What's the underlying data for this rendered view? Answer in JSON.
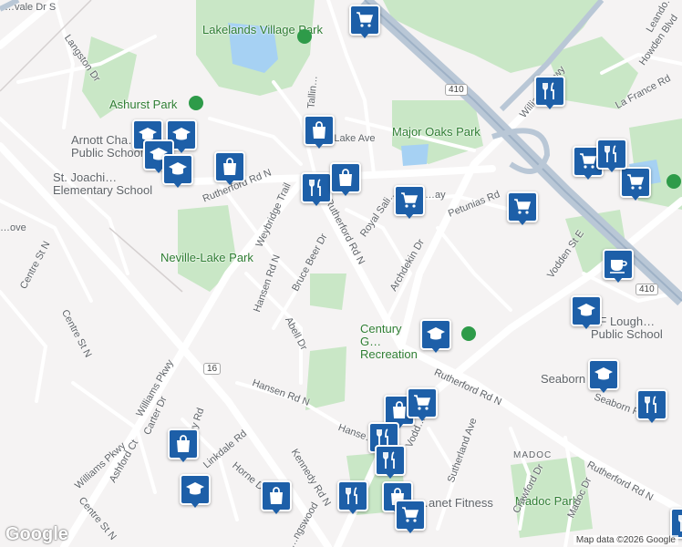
{
  "map": {
    "attribution": "Map data ©2026 Google",
    "logo": "Google",
    "colors": {
      "background": "#f5f3f3",
      "park": "#c9e7c6",
      "water": "#a6d1f3",
      "highway": "#b9c7d6",
      "road": "#ffffff",
      "marker": "#1d5fa8"
    }
  },
  "parks": {
    "lakelands": "Lakelands Village Park",
    "ashurst": "Ashurst Park",
    "major_oaks": "Major Oaks Park",
    "neville_lake": "Neville-Lake Park",
    "madoc": "Madoc Park",
    "century_gardens": "Century G… Recreation"
  },
  "places": {
    "arnott": "Arnott Cha… Public School",
    "st_joachim": "St. Joachi… Elementary School",
    "hf_lough": "HF Lough… Public School",
    "seaborn": "Seaborn",
    "madoc_label": "MADOC",
    "fitness": "…anet Fitness"
  },
  "streets": {
    "rutherford_w": "Rutherford Rd N",
    "rutherford_mid": "Rutherford Rd N",
    "rutherford_e": "Rutherford Rd N",
    "rutherford_se": "Rutherford Rd N",
    "williams1": "Williams Pkwy",
    "williams2": "Williams Pkwy",
    "williams3": "Williams Pkwy",
    "kennedy": "Kennedy Rd N",
    "centre1": "Centre St N",
    "centre2": "Centre St N",
    "centre3": "Centre St N",
    "vodden": "Vodden St E",
    "howden": "Howden Blvd",
    "hansen1": "Hansen Rd N",
    "hansen2": "Hansen Rd N",
    "hansen3": "Hanse…",
    "bruce_beer": "Bruce Beer Dr",
    "abell": "Abell Dr",
    "archdekin": "Archdekin Dr",
    "petunias": "Petunias Rd",
    "royal_salisbury": "Royal Sali…",
    "way": "…ay",
    "weybridge": "Weybridge Trail",
    "langston": "Langston Dr",
    "tallin": "Tallin…",
    "lake_ave": "S… Lake Ave",
    "la_france": "La France Rd",
    "leander": "Leando…",
    "lvale": "…vale Dr S",
    "sutherland": "Sutherland Ave",
    "crawford": "Crawford Dr",
    "madoc_dr": "Madoc Dr",
    "carter": "Carter Dr",
    "ashford": "Ashford Ct",
    "rugby": "Rugby Rd",
    "linkdale": "Linkdale Rd",
    "horne": "Horne D…",
    "kingswood": "…ngswood",
    "seaborn_rd": "Seaborn R…",
    "wood": "Vodd…",
    "cove": "…ove",
    "hwy410": "410",
    "hwy410b": "410",
    "hwy16": "16"
  },
  "markers": [
    {
      "type": "shopping",
      "icon": "cart-icon"
    },
    {
      "type": "restaurant",
      "icon": "fork-knife-icon"
    },
    {
      "type": "shopping",
      "icon": "bag-icon"
    },
    {
      "type": "school",
      "icon": "graduation-cap-icon"
    },
    {
      "type": "school",
      "icon": "graduation-cap-icon"
    },
    {
      "type": "school",
      "icon": "graduation-cap-icon"
    },
    {
      "type": "shopping",
      "icon": "bag-icon"
    },
    {
      "type": "restaurant",
      "icon": "fork-knife-icon"
    },
    {
      "type": "shopping",
      "icon": "bag-icon"
    },
    {
      "type": "shopping",
      "icon": "cart-icon"
    },
    {
      "type": "shopping",
      "icon": "cart-icon"
    },
    {
      "type": "shopping",
      "icon": "cart-icon"
    },
    {
      "type": "restaurant",
      "icon": "fork-knife-icon"
    },
    {
      "type": "shopping",
      "icon": "cart-icon"
    },
    {
      "type": "cafe",
      "icon": "coffee-cup-icon"
    },
    {
      "type": "school",
      "icon": "graduation-cap-icon"
    },
    {
      "type": "school",
      "icon": "graduation-cap-icon"
    },
    {
      "type": "school",
      "icon": "graduation-cap-icon"
    },
    {
      "type": "restaurant",
      "icon": "fork-knife-icon"
    },
    {
      "type": "school",
      "icon": "graduation-cap-icon"
    },
    {
      "type": "shopping",
      "icon": "bag-icon"
    },
    {
      "type": "shopping",
      "icon": "cart-icon"
    },
    {
      "type": "restaurant",
      "icon": "fork-knife-icon"
    },
    {
      "type": "restaurant",
      "icon": "fork-knife-icon"
    },
    {
      "type": "shopping",
      "icon": "bag-icon"
    },
    {
      "type": "school",
      "icon": "graduation-cap-icon"
    },
    {
      "type": "shopping",
      "icon": "bag-icon"
    },
    {
      "type": "restaurant",
      "icon": "fork-knife-icon"
    },
    {
      "type": "shopping",
      "icon": "bag-icon"
    },
    {
      "type": "shopping",
      "icon": "cart-icon"
    },
    {
      "type": "restaurant",
      "icon": "fork-knife-icon"
    }
  ]
}
